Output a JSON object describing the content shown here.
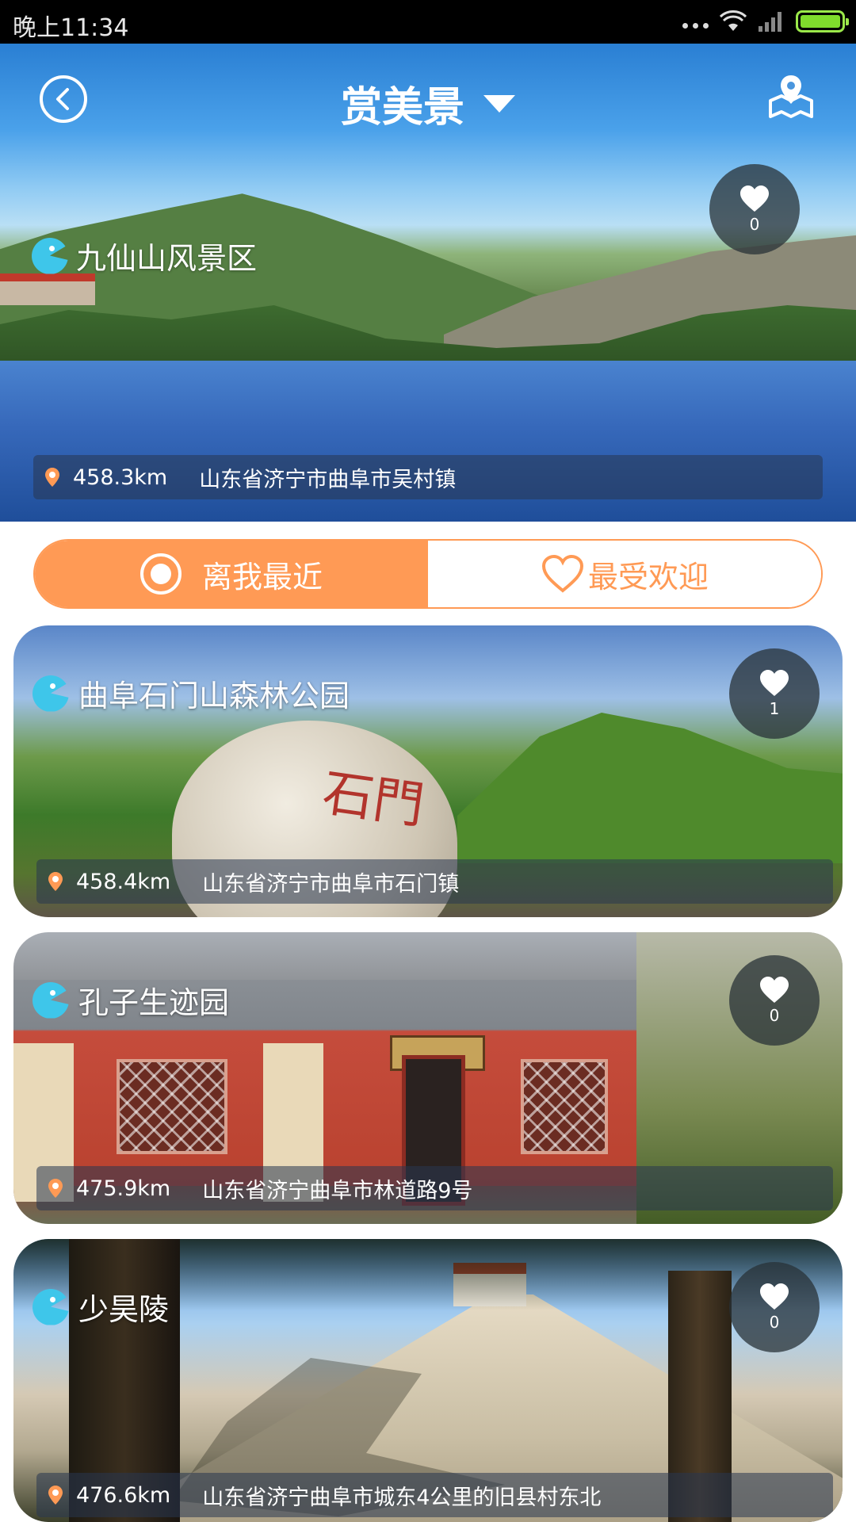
{
  "status_bar": {
    "time": "晚上11:34"
  },
  "header": {
    "title": "赏美景"
  },
  "featured": {
    "name": "九仙山风景区",
    "likes": "0",
    "distance": "458.3km",
    "address": "山东省济宁市曲阜市吴村镇"
  },
  "tabs": {
    "nearest": "离我最近",
    "popular": "最受欢迎"
  },
  "spots": [
    {
      "name": "曲阜石门山森林公园",
      "likes": "1",
      "distance": "458.4km",
      "address": "山东省济宁市曲阜市石门镇"
    },
    {
      "name": "孔子生迹园",
      "likes": "0",
      "distance": "475.9km",
      "address": "山东省济宁曲阜市林道路9号"
    },
    {
      "name": "少昊陵",
      "likes": "0",
      "distance": "476.6km",
      "address": "山东省济宁曲阜市城东4公里的旧县村东北"
    }
  ],
  "rock_carving": "石門",
  "colors": {
    "accent": "#ff9a55",
    "icon_blue": "#3ec6ea"
  },
  "icons": [
    "back-icon",
    "dropdown-caret-icon",
    "map-pin-icon",
    "heart-icon",
    "location-pin-icon",
    "target-icon",
    "pacman-logo-icon",
    "wifi-icon",
    "signal-icon",
    "battery-icon"
  ]
}
